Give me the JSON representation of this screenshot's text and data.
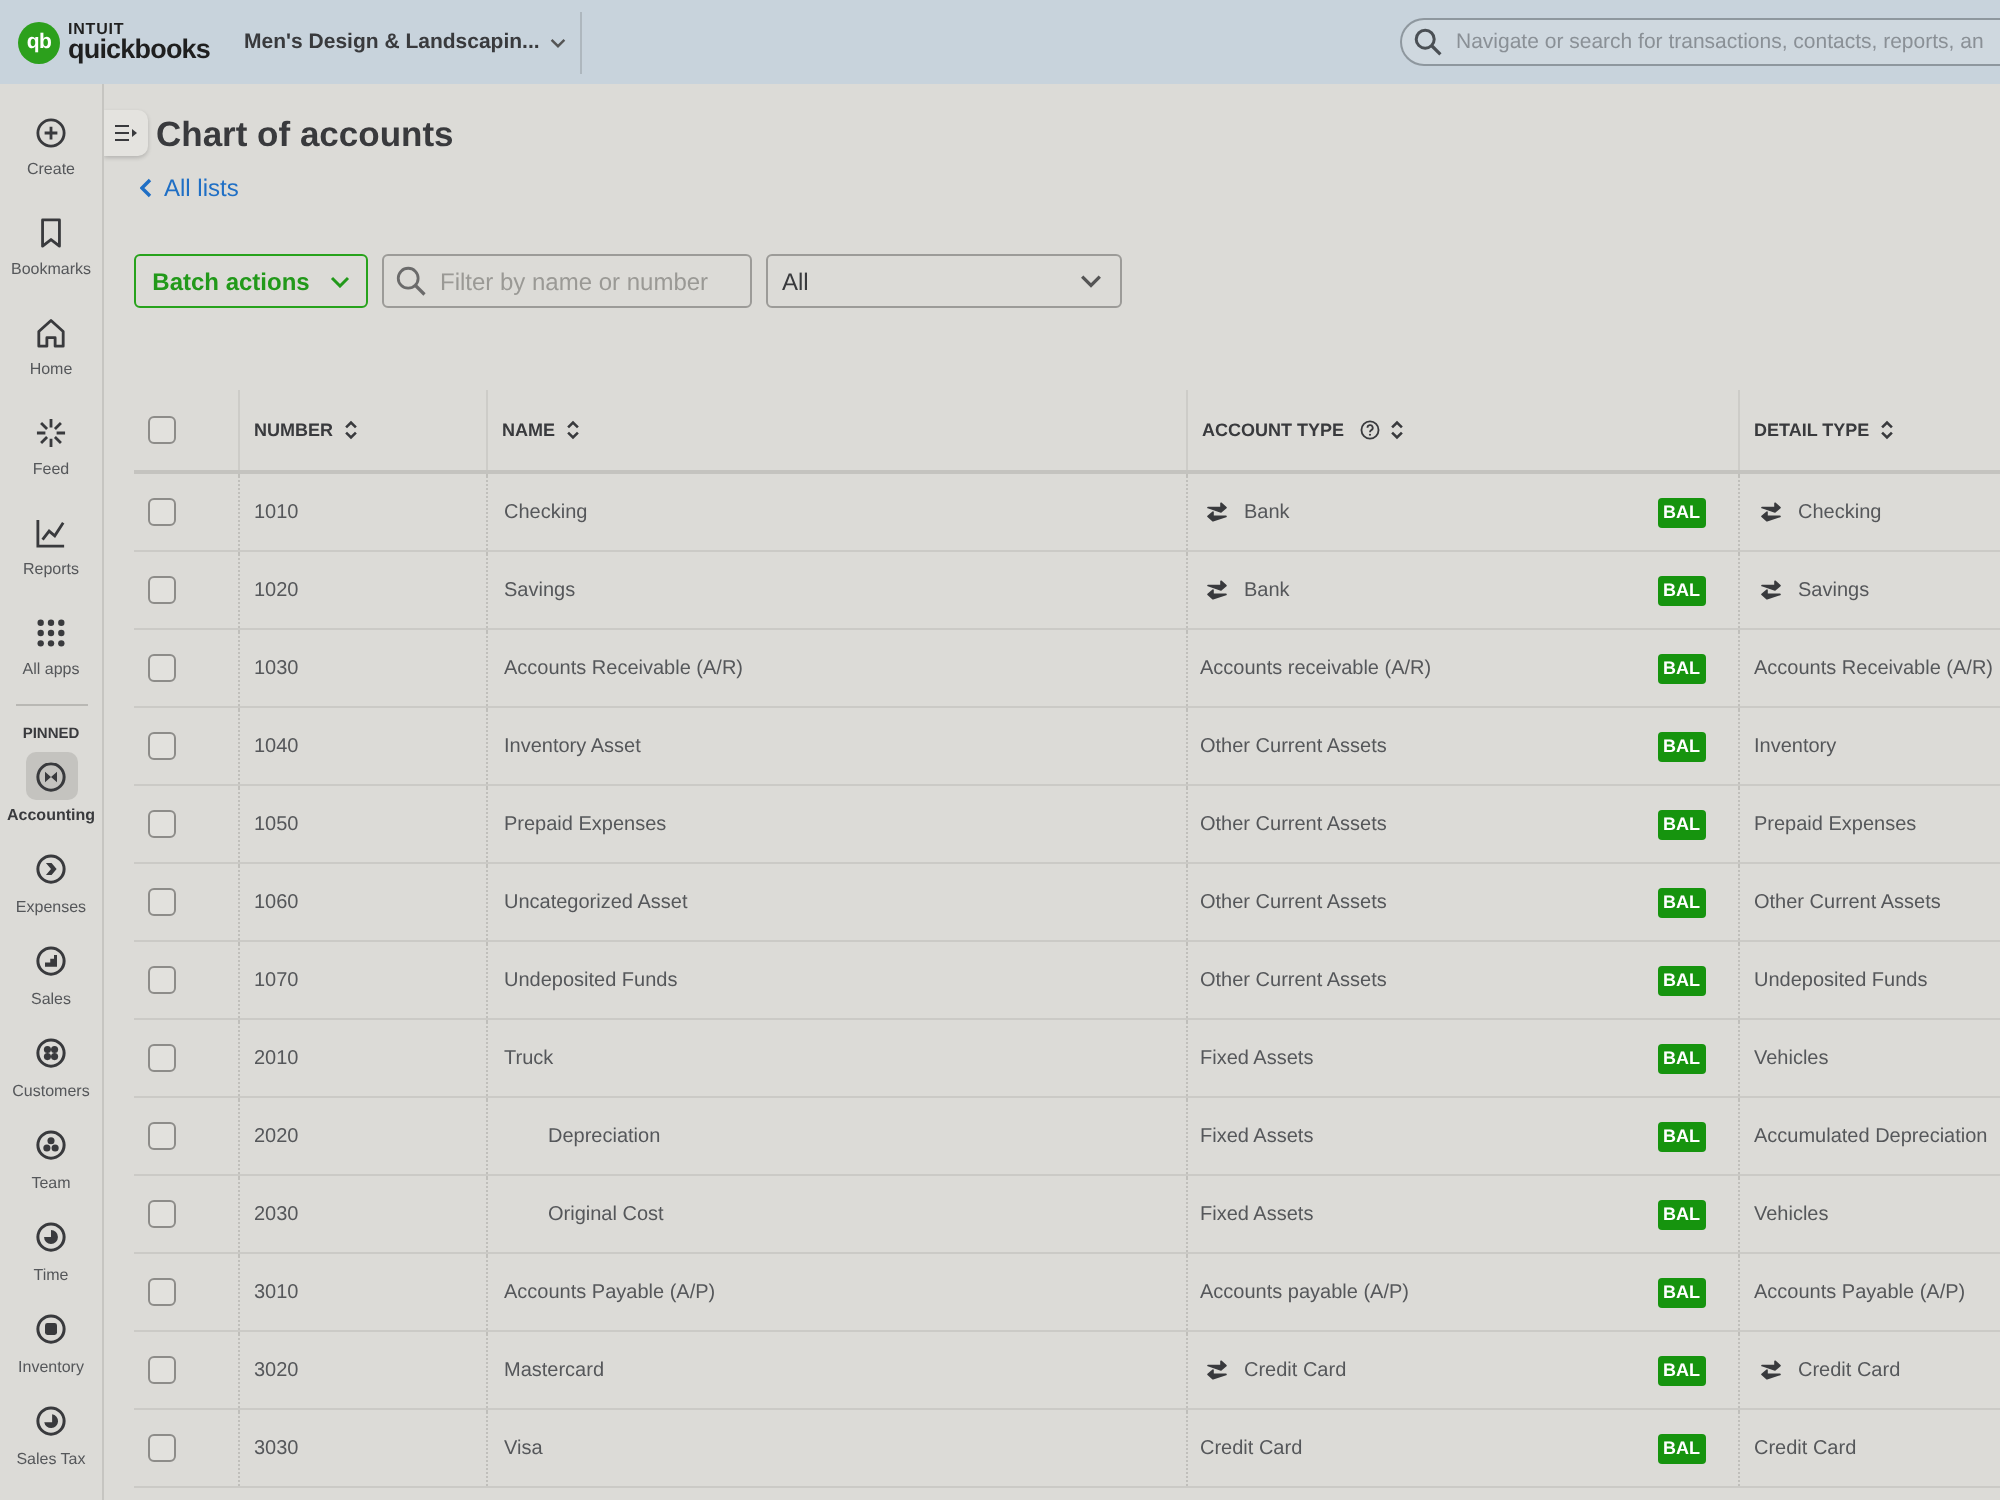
{
  "top_bar": {
    "logo": {
      "mark": "qb",
      "brand": "INTUIT",
      "product": "quickbooks"
    },
    "company": "Men's Design & Landscapin...",
    "search": {
      "placeholder": "Navigate or search for transactions, contacts, reports, an"
    }
  },
  "sidebar": {
    "items": [
      {
        "label": "Create",
        "selected": false
      },
      {
        "label": "Bookmarks",
        "selected": false
      },
      {
        "label": "Home",
        "selected": false
      },
      {
        "label": "Feed",
        "selected": false
      },
      {
        "label": "Reports",
        "selected": false
      },
      {
        "label": "All apps",
        "selected": false
      }
    ],
    "pinned_heading": "PINNED",
    "pinned_items": [
      {
        "label": "Accounting",
        "selected": true
      },
      {
        "label": "Expenses",
        "selected": false
      },
      {
        "label": "Sales",
        "selected": false
      },
      {
        "label": "Customers",
        "selected": false
      },
      {
        "label": "Team",
        "selected": false
      },
      {
        "label": "Time",
        "selected": false
      },
      {
        "label": "Inventory",
        "selected": false
      },
      {
        "label": "Sales Tax",
        "selected": false
      }
    ]
  },
  "page": {
    "title": "Chart of accounts",
    "back_link": "All lists"
  },
  "toolbar": {
    "batch_actions": "Batch actions",
    "filter": {
      "placeholder": "Filter by name or number"
    },
    "type_dropdown": {
      "value": "All"
    }
  },
  "table": {
    "select_all": {
      "checked": false
    },
    "columns": [
      {
        "label": "NUMBER",
        "help": false
      },
      {
        "label": "NAME",
        "help": false
      },
      {
        "label": "ACCOUNT TYPE",
        "help": true
      },
      {
        "label": "DETAIL TYPE",
        "help": false
      }
    ],
    "rows": [
      {
        "number": "1010",
        "name": "Checking",
        "account_type": "Bank",
        "detail_type": "Checking",
        "connected": true,
        "badge": "BAL",
        "checked": false
      },
      {
        "number": "1020",
        "name": "Savings",
        "account_type": "Bank",
        "detail_type": "Savings",
        "connected": true,
        "badge": "BAL",
        "checked": false
      },
      {
        "number": "1030",
        "name": "Accounts Receivable (A/R)",
        "account_type": "Accounts receivable (A/R)",
        "detail_type": "Accounts Receivable (A/R)",
        "connected": false,
        "badge": "BAL",
        "checked": false
      },
      {
        "number": "1040",
        "name": "Inventory Asset",
        "account_type": "Other Current Assets",
        "detail_type": "Inventory",
        "connected": false,
        "badge": "BAL",
        "checked": false
      },
      {
        "number": "1050",
        "name": "Prepaid Expenses",
        "account_type": "Other Current Assets",
        "detail_type": "Prepaid Expenses",
        "connected": false,
        "badge": "BAL",
        "checked": false
      },
      {
        "number": "1060",
        "name": "Uncategorized Asset",
        "account_type": "Other Current Assets",
        "detail_type": "Other Current Assets",
        "connected": false,
        "badge": "BAL",
        "checked": false
      },
      {
        "number": "1070",
        "name": "Undeposited Funds",
        "account_type": "Other Current Assets",
        "detail_type": "Undeposited Funds",
        "connected": false,
        "badge": "BAL",
        "checked": false
      },
      {
        "number": "2010",
        "name": "Truck",
        "account_type": "Fixed Assets",
        "detail_type": "Vehicles",
        "connected": false,
        "badge": "BAL",
        "checked": false,
        "children": [
          {
            "number": "2020",
            "name": "Depreciation",
            "account_type": "Fixed Assets",
            "detail_type": "Accumulated Depreciation",
            "connected": false,
            "badge": "BAL",
            "checked": false
          },
          {
            "number": "2030",
            "name": "Original Cost",
            "account_type": "Fixed Assets",
            "detail_type": "Vehicles",
            "connected": false,
            "badge": "BAL",
            "checked": false
          }
        ]
      },
      {
        "number": "3010",
        "name": "Accounts Payable (A/P)",
        "account_type": "Accounts payable (A/P)",
        "detail_type": "Accounts Payable (A/P)",
        "connected": false,
        "badge": "BAL",
        "checked": false
      },
      {
        "number": "3020",
        "name": "Mastercard",
        "account_type": "Credit Card",
        "detail_type": "Credit Card",
        "connected": true,
        "badge": "BAL",
        "checked": false
      },
      {
        "number": "3030",
        "name": "Visa",
        "account_type": "Credit Card",
        "detail_type": "Credit Card",
        "connected": false,
        "badge": "BAL",
        "checked": false
      }
    ]
  }
}
